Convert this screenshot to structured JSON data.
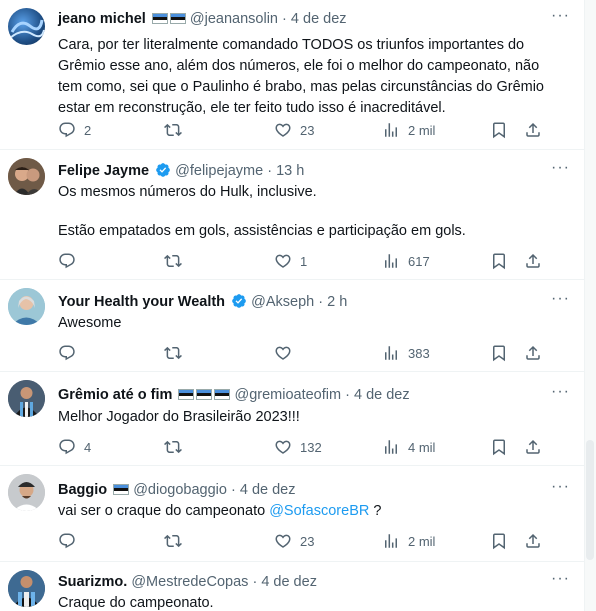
{
  "tweets": [
    {
      "name": "jeano michel",
      "handle": "@jeanansolin",
      "time": "4 de dez",
      "flags": 2,
      "verified": false,
      "text": [
        "Cara, por ter literalmente comandado TODOS os triunfos importantes do Grêmio esse ano, além dos números, ele foi o melhor do campeonato, não tem como, sei que o Paulinho é brabo, mas pelas circunstâncias do Grêmio estar em reconstrução, ele ter feito tudo isso é inacreditável."
      ],
      "replies": "2",
      "retweets": "",
      "likes": "23",
      "views": "2 mil",
      "avatar_icon": "avatar-blue-pattern"
    },
    {
      "name": "Felipe Jayme",
      "handle": "@felipejayme",
      "time": "13 h",
      "flags": 0,
      "verified": true,
      "text": [
        "Os mesmos números do Hulk, inclusive.",
        "",
        "Estão empatados em gols, assistências e participação em gols."
      ],
      "replies": "",
      "retweets": "",
      "likes": "1",
      "views": "617",
      "avatar_icon": "avatar-man-photo"
    },
    {
      "name": "Your Health your Wealth",
      "handle": "@Akseph",
      "time": "2 h",
      "flags": 0,
      "verified": true,
      "text": [
        "Awesome"
      ],
      "replies": "",
      "retweets": "",
      "likes": "",
      "views": "383",
      "avatar_icon": "avatar-woman-photo"
    },
    {
      "name": "Grêmio até o fim",
      "handle": "@gremioateofim",
      "time": "4 de dez",
      "flags": 3,
      "verified": false,
      "text": [
        "Melhor Jogador do Brasileirão 2023!!!"
      ],
      "replies": "4",
      "retweets": "",
      "likes": "132",
      "views": "4 mil",
      "avatar_icon": "avatar-player-photo"
    },
    {
      "name": "Baggio",
      "handle": "@diogobaggio",
      "time": "4 de dez",
      "flags": 1,
      "verified": false,
      "text_before": "vai ser o craque do campeonato ",
      "mention": "@SofascoreBR",
      "text_after": " ?",
      "replies": "",
      "retweets": "",
      "likes": "23",
      "views": "2 mil",
      "avatar_icon": "avatar-man-cap-photo"
    },
    {
      "name": "Suarizmo.",
      "handle": "@MestredeCopas",
      "time": "4 de dez",
      "flags": 0,
      "verified": false,
      "text": [
        "Craque do campeonato."
      ],
      "avatar_icon": "avatar-gremio-shirt-photo"
    }
  ],
  "more_label": "···",
  "colors": {
    "text": "#0f1419",
    "muted": "#536471",
    "link": "#1d9bf0",
    "verified": "#1d9bf0",
    "divider": "#eff3f4"
  }
}
